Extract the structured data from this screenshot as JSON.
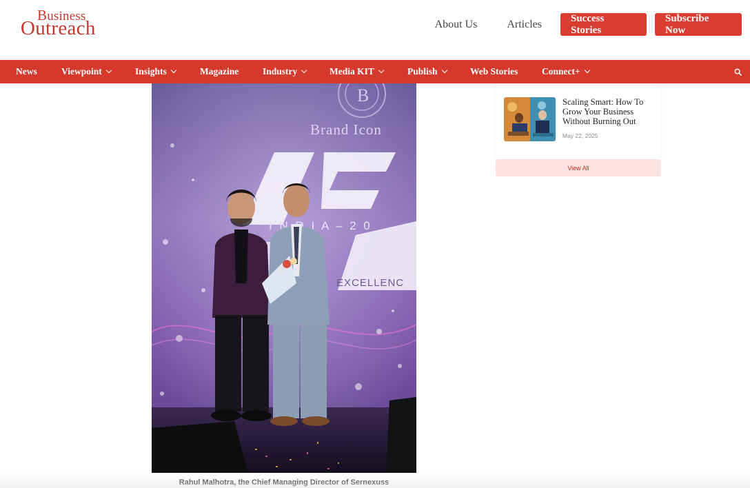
{
  "logo": {
    "line1_initial": "B",
    "line1_rest": "usiness",
    "line2": "Outreach"
  },
  "header": {
    "links": [
      "About Us",
      "Articles"
    ],
    "success_label": "Success Stories",
    "subscribe_label": "Subscribe Now"
  },
  "nav": {
    "items": [
      {
        "label": "News",
        "dropdown": false
      },
      {
        "label": "Viewpoint",
        "dropdown": true
      },
      {
        "label": "Insights",
        "dropdown": true
      },
      {
        "label": "Magazine",
        "dropdown": false
      },
      {
        "label": "Industry",
        "dropdown": true
      },
      {
        "label": "Media KIT",
        "dropdown": true
      },
      {
        "label": "Publish",
        "dropdown": true
      },
      {
        "label": "Web Stories",
        "dropdown": false
      },
      {
        "label": "Connect+",
        "dropdown": true
      }
    ],
    "search_icon": "search-icon"
  },
  "article": {
    "photo_backdrop": {
      "brand_text": "Brand Icon",
      "banner_text": "I N D I A  –  2 0",
      "excellence_text": "EXCELLENC"
    },
    "caption": "Rahul Malhotra, the Chief Managing Director of Sernexuss"
  },
  "sidebar": {
    "post": {
      "title": "Scaling Smart: How To Grow Your Business Without Burning Out",
      "date": "May 22, 2025"
    },
    "view_all_label": "View All"
  },
  "colors": {
    "brand_red": "#d4392c",
    "button_red": "#d93c30",
    "logo_red": "#c8372d",
    "view_all_bg": "#fbe3e1"
  }
}
